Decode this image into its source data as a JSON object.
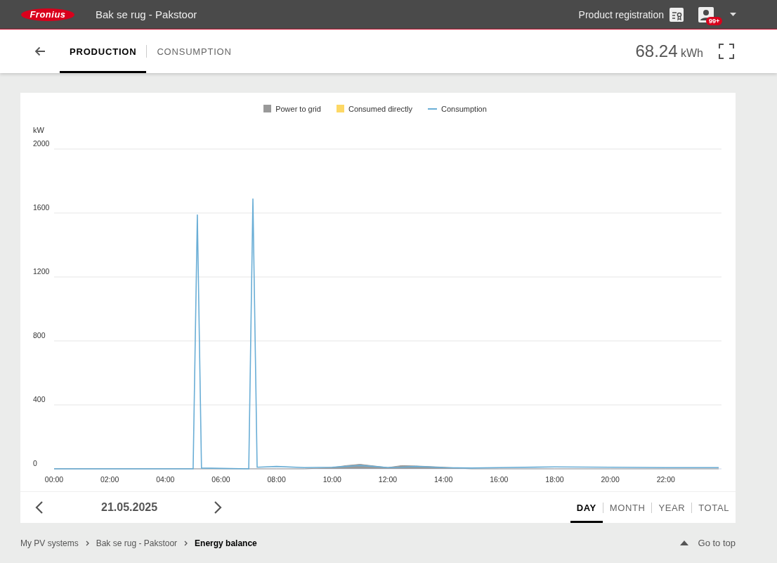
{
  "header": {
    "logo": "Fronius",
    "title": "Bak se rug - Pakstoor",
    "product_registration": "Product registration",
    "notification_badge": "99+"
  },
  "tabs": [
    {
      "label": "PRODUCTION",
      "selected": true
    },
    {
      "label": "CONSUMPTION",
      "selected": false
    }
  ],
  "total": {
    "value": "68.24",
    "unit": "kWh"
  },
  "chart": {
    "chart_data": {
      "type": "line",
      "grid": true,
      "ylabel": "kW",
      "xlim": [
        0,
        24
      ],
      "ylim": [
        0,
        2000
      ],
      "x": [
        0,
        5,
        5.15,
        5.3,
        7,
        7.15,
        7.3,
        8,
        9,
        10,
        10.5,
        11,
        11.5,
        12,
        12.5,
        13,
        14,
        15,
        16,
        18,
        20,
        22,
        23.9
      ],
      "series": [
        {
          "name": "Power to grid",
          "type": "area",
          "color": "#999999",
          "values": [
            0,
            0,
            0,
            0,
            0,
            0,
            0,
            0,
            0,
            8,
            20,
            28,
            18,
            8,
            20,
            18,
            10,
            0,
            0,
            0,
            0,
            0,
            0
          ]
        },
        {
          "name": "Consumed directly",
          "type": "area",
          "color": "#fdd865",
          "values": [
            null,
            null,
            null,
            null,
            null,
            null,
            null,
            null,
            null,
            null,
            null,
            null,
            null,
            null,
            null,
            null,
            null,
            null,
            null,
            null,
            null,
            null,
            null
          ]
        },
        {
          "name": "Consumption",
          "type": "line",
          "color": "#6aaed6",
          "values": [
            0,
            0,
            1590,
            5,
            0,
            1690,
            10,
            15,
            8,
            10,
            15,
            20,
            15,
            8,
            10,
            15,
            8,
            5,
            8,
            12,
            10,
            8,
            8
          ]
        }
      ],
      "xticks": [
        {
          "value": 0,
          "label": "00:00"
        },
        {
          "value": 2,
          "label": "02:00"
        },
        {
          "value": 4,
          "label": "04:00"
        },
        {
          "value": 6,
          "label": "06:00"
        },
        {
          "value": 8,
          "label": "08:00"
        },
        {
          "value": 10,
          "label": "10:00"
        },
        {
          "value": 12,
          "label": "12:00"
        },
        {
          "value": 14,
          "label": "14:00"
        },
        {
          "value": 16,
          "label": "16:00"
        },
        {
          "value": 18,
          "label": "18:00"
        },
        {
          "value": 20,
          "label": "20:00"
        },
        {
          "value": 22,
          "label": "22:00"
        }
      ],
      "yticks": [
        0,
        400,
        800,
        1200,
        1600,
        2000
      ]
    }
  },
  "date": "21.05.2025",
  "periods": [
    {
      "label": "DAY",
      "selected": true
    },
    {
      "label": "MONTH",
      "selected": false
    },
    {
      "label": "YEAR",
      "selected": false
    },
    {
      "label": "TOTAL",
      "selected": false
    }
  ],
  "breadcrumb": [
    {
      "label": "My PV systems",
      "current": false
    },
    {
      "label": "Bak se rug - Pakstoor",
      "current": false
    },
    {
      "label": "Energy balance",
      "current": true
    }
  ],
  "go_to_top": "Go to top"
}
